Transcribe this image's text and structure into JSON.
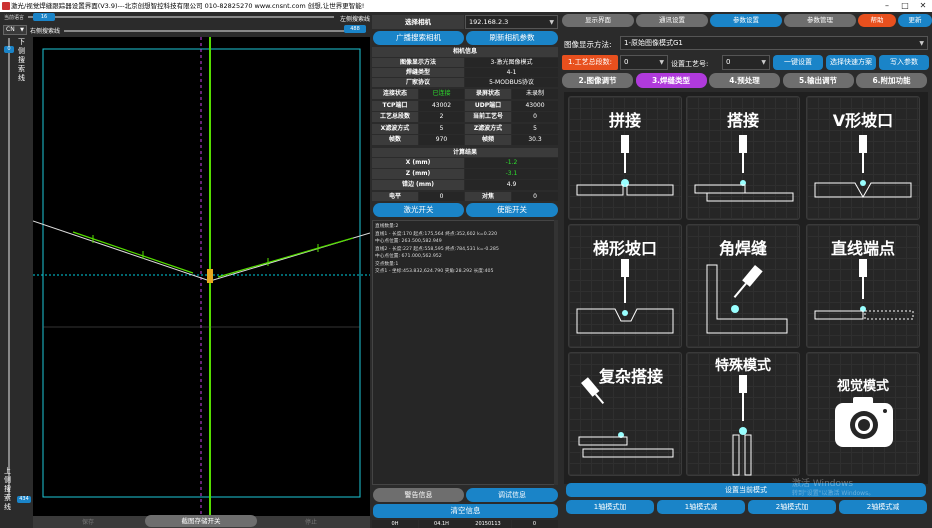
{
  "window": {
    "title": "激光/视觉焊缝跟踪器设置界面(V3.9)---北京创想智控科技有限公司 010-82825270 www.cnsnt.com 创想,让世界更智能!"
  },
  "left": {
    "lang_label": "当前语言",
    "lang": "CN",
    "left_search": "右侧搜索线",
    "left_search_val": "16",
    "right_search": "左侧搜索线",
    "right_search_val": "488",
    "vtext_top": "下侧搜索线",
    "vtext_top_val": "0",
    "vtext_bottom": "上侧搜索线",
    "vtext_bottom_val": "434",
    "bottom_btn": "截图存储开关",
    "bottom_left": "保存",
    "bottom_right": "停止"
  },
  "mid": {
    "select_cam_label": "选择相机",
    "select_cam_value": "192.168.2.3",
    "broadcast_btn": "广播搜索相机",
    "refresh_btn": "刷新相机参数",
    "cam_info_title": "相机信息",
    "rows": [
      {
        "a": "图像显示方法",
        "b": "3-激光图像模式"
      },
      {
        "a": "焊缝类型",
        "b": "4-1"
      },
      {
        "a": "厂家协议",
        "b": "5-MODBUS协议"
      }
    ],
    "status_rows": [
      {
        "a": "连接状态",
        "b": "已连接",
        "c": "录屏状态",
        "d": "未录制"
      },
      {
        "a": "TCP端口",
        "b": "43002",
        "c": "UDP端口",
        "d": "43000"
      },
      {
        "a": "工艺总段数",
        "b": "2",
        "c": "当前工艺号",
        "d": "0"
      },
      {
        "a": "X滤波方式",
        "b": "5",
        "c": "Z滤波方式",
        "d": "5"
      },
      {
        "a": "帧数",
        "b": "970",
        "c": "帧频",
        "d": "30.3"
      }
    ],
    "calc_title": "计算结果",
    "calc_rows": [
      {
        "a": "X (mm)",
        "b": "-1.2"
      },
      {
        "a": "Z (mm)",
        "b": "-3.1"
      },
      {
        "a": "错边 (mm)",
        "b": "4.9"
      }
    ],
    "level_label": "电平",
    "level_val": "0",
    "contrast_label": "对焦",
    "contrast_val": "0",
    "laser_btn": "激光开关",
    "enable_btn": "使能开关",
    "log": [
      "直线数量:2",
      "直线1 - 长度:170 起点:175,564 终点:352,602 k=0.220",
      "中心点位置: 263.500,582.949",
      "直线2 - 长度:227 起点:558,595 终点:784,531 k=-0.285",
      "中心点位置: 671.000,562.952",
      "交点数量:1",
      "交点1 - 坐标:453.832,624.790 夹角:28.292 长度:405"
    ],
    "warn_tab": "警告信息",
    "debug_tab": "调试信息",
    "clear_btn": "清空信息",
    "footer": [
      "0H",
      "04.1H",
      "20150113",
      "0"
    ]
  },
  "right": {
    "tabs": [
      "显示界面",
      "通讯设置",
      "参数设置",
      "参数管理",
      "帮助",
      "更新"
    ],
    "display_mode_label": "图像显示方法:",
    "display_mode_value": "1-原始图像模式G1",
    "total_label": "1.工艺总段数:",
    "total_value": "0",
    "set_label": "设置工艺号:",
    "set_value": "0",
    "btn_onekey": "一键设置",
    "btn_quick": "选择快速方案",
    "btn_write": "写入参数",
    "subtabs": [
      "2.图像调节",
      "3.焊缝类型",
      "4.预处理",
      "5.输出调节",
      "6.附加功能"
    ],
    "cards": [
      "拼接",
      "搭接",
      "V形坡口",
      "梯形坡口",
      "角焊缝",
      "直线端点",
      "复杂搭接",
      "特殊模式",
      "视觉模式"
    ],
    "set_mode_btn": "设置当前模式",
    "axis_btns": [
      "1轴模式加",
      "1轴模式减",
      "2轴模式加",
      "2轴模式减"
    ],
    "watermark1": "激活 Windows",
    "watermark2": "转到\"设置\"以激活 Windows。"
  },
  "colors": {
    "accent": "#1a84c8",
    "active_red": "#e8501e",
    "green": "#00d000",
    "cyan": "#00c8d8"
  }
}
